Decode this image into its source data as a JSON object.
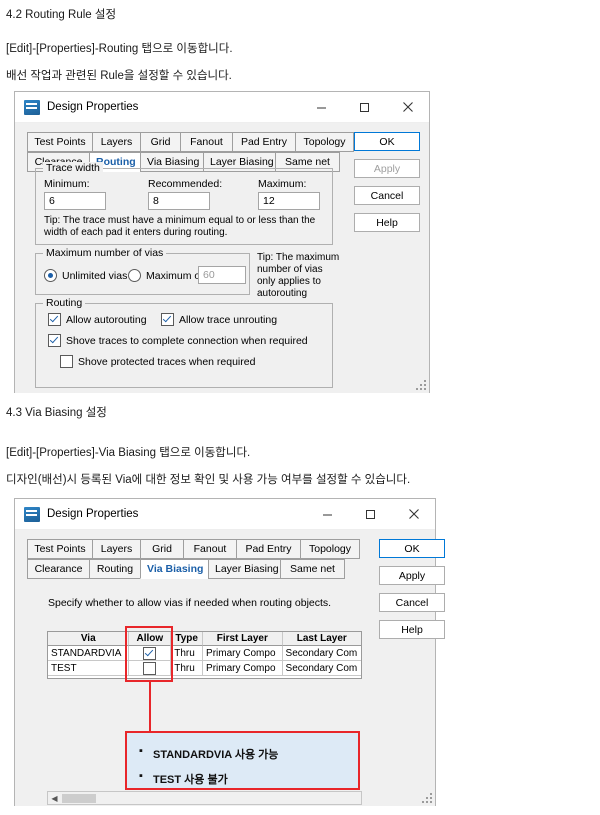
{
  "doc": {
    "section_42_title": "4.2 Routing Rule 설정",
    "section_42_line1": "[Edit]-[Properties]-Routing 탭으로 이동합니다.",
    "section_42_line2": "배선 작업과 관련된 Rule을 설정할 수 있습니다.",
    "section_43_title": "4.3 Via Biasing 설정",
    "section_43_line1": "[Edit]-[Properties]-Via Biasing 탭으로 이동합니다.",
    "section_43_line2": "디자인(배선)시 등록된 Via에 대한 정보 확인 및 사용 가능 여부를 설정할 수 있습니다."
  },
  "dialog1": {
    "title": "Design Properties",
    "window_buttons": {
      "minimize": "minimize-icon",
      "maximize": "maximize-icon",
      "close": "close-icon"
    },
    "tabs_row1": [
      "Test Points",
      "Layers",
      "Grid",
      "Fanout",
      "Pad Entry",
      "Topology"
    ],
    "tabs_row2": [
      "Clearance",
      "Routing",
      "Via Biasing",
      "Layer Biasing",
      "Same net"
    ],
    "selected_tab": "Routing",
    "trace_width": {
      "group_label": "Trace width",
      "minimum_label": "Minimum:",
      "minimum_value": "6",
      "recommended_label": "Recommended:",
      "recommended_value": "8",
      "maximum_label": "Maximum:",
      "maximum_value": "12",
      "tip": "Tip: The trace must have a minimum equal to or less than the width of each pad it enters during routing."
    },
    "max_vias": {
      "group_label": "Maximum number of vias",
      "unlimited_label": "Unlimited vias",
      "maximum_of_label": "Maximum of:",
      "maximum_of_value": "60",
      "selected": "Unlimited vias",
      "tip": "Tip: The maximum number of vias only applies to autorouting"
    },
    "routing": {
      "group_label": "Routing",
      "allow_autorouting": {
        "label": "Allow autorouting",
        "checked": true
      },
      "allow_trace_unrouting": {
        "label": "Allow trace unrouting",
        "checked": true
      },
      "shove_traces": {
        "label": "Shove traces to complete connection when required",
        "checked": true
      },
      "shove_protected": {
        "label": "Shove protected traces when required",
        "checked": false
      }
    },
    "buttons": {
      "ok": "OK",
      "apply": "Apply",
      "cancel": "Cancel",
      "help": "Help"
    }
  },
  "dialog2": {
    "title": "Design Properties",
    "tabs_row1": [
      "Test Points",
      "Layers",
      "Grid",
      "Fanout",
      "Pad Entry",
      "Topology"
    ],
    "tabs_row2": [
      "Clearance",
      "Routing",
      "Via Biasing",
      "Layer Biasing",
      "Same net"
    ],
    "selected_tab": "Via Biasing",
    "description": "Specify whether to allow vias if needed when routing objects.",
    "table": {
      "headers": [
        "Via",
        "Allow",
        "Type",
        "First Layer",
        "Last Layer"
      ],
      "rows": [
        {
          "via": "STANDARDVIA",
          "allow": true,
          "type": "Thru",
          "first_layer": "Primary Compo",
          "last_layer": "Secondary Com"
        },
        {
          "via": "TEST",
          "allow": false,
          "type": "Thru",
          "first_layer": "Primary Compo",
          "last_layer": "Secondary Com"
        }
      ]
    },
    "callout": {
      "items": [
        "STANDARDVIA 사용 가능",
        "TEST 사용 불가"
      ]
    },
    "buttons": {
      "ok": "OK",
      "apply": "Apply",
      "cancel": "Cancel",
      "help": "Help"
    }
  }
}
